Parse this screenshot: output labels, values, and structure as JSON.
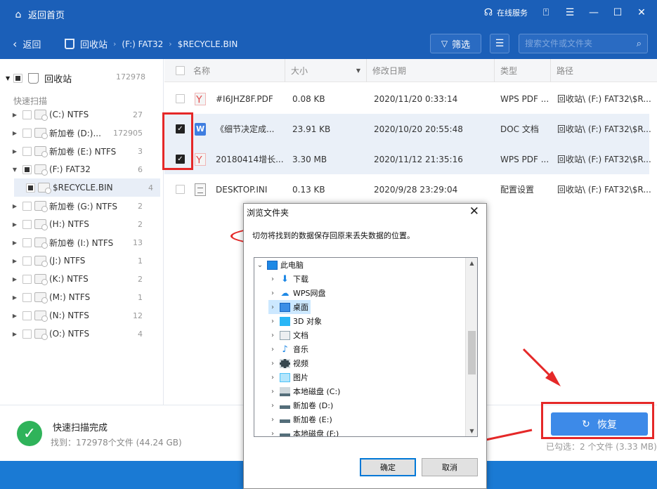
{
  "titlebar": {
    "home_label": "返回首页",
    "service_label": "在线服务"
  },
  "toolbar": {
    "back_label": "返回",
    "breadcrumb": [
      "回收站",
      "(F:) FAT32",
      "$RECYCLE.BIN"
    ],
    "filter_label": "筛选",
    "search_placeholder": "搜索文件或文件夹"
  },
  "tree": {
    "root": {
      "label": "回收站",
      "count": "172978"
    },
    "section_label": "快速扫描",
    "items": [
      {
        "label": "(C:) NTFS",
        "count": "27"
      },
      {
        "label": "新加卷 (D:)...",
        "count": "172905"
      },
      {
        "label": "新加卷 (E:) NTFS",
        "count": "3"
      },
      {
        "label": "(F:) FAT32",
        "count": "6"
      },
      {
        "label": "$RECYCLE.BIN",
        "count": "4"
      },
      {
        "label": "新加卷 (G:) NTFS",
        "count": "2"
      },
      {
        "label": "(H:) NTFS",
        "count": "2"
      },
      {
        "label": "新加卷 (I:) NTFS",
        "count": "13"
      },
      {
        "label": "(J:) NTFS",
        "count": "1"
      },
      {
        "label": "(K:) NTFS",
        "count": "2"
      },
      {
        "label": "(M:) NTFS",
        "count": "1"
      },
      {
        "label": "(N:) NTFS",
        "count": "12"
      },
      {
        "label": "(O:) NTFS",
        "count": "4"
      }
    ]
  },
  "table": {
    "columns": [
      "名称",
      "大小",
      "修改日期",
      "类型",
      "路径"
    ],
    "rows": [
      {
        "name": "#I6JHZ8F.PDF",
        "size": "0.08 KB",
        "date": "2020/11/20 0:33:14",
        "type": "WPS PDF ...",
        "path": "回收站\\ (F:) FAT32\\$R...",
        "checked": false,
        "icon": "pdf-icon"
      },
      {
        "name": "《细节决定成...",
        "size": "23.91 KB",
        "date": "2020/10/20 20:55:48",
        "type": "DOC 文档",
        "path": "回收站\\ (F:) FAT32\\$R...",
        "checked": true,
        "icon": "word-doc-icon"
      },
      {
        "name": "20180414增长...",
        "size": "3.30 MB",
        "date": "2020/11/12 21:35:16",
        "type": "WPS PDF ...",
        "path": "回收站\\ (F:) FAT32\\$R...",
        "checked": true,
        "icon": "pdf-icon"
      },
      {
        "name": "DESKTOP.INI",
        "size": "0.13 KB",
        "date": "2020/9/28 23:29:04",
        "type": "配置设置",
        "path": "回收站\\ (F:) FAT32\\$R...",
        "checked": false,
        "icon": "ini-file-icon"
      }
    ]
  },
  "status": {
    "title": "快速扫描完成",
    "found": "找到：172978个文件 (44.24 GB)",
    "recover_label": "恢复",
    "selected": "已勾选：2 个文件 (3.33 MB)"
  },
  "dialog": {
    "title": "浏览文件夹",
    "description": "切勿将找到的数据保存回原来丢失数据的位置。",
    "folders": [
      {
        "label": "此电脑",
        "icon": "computer-icon",
        "expanded": true,
        "selected": false,
        "level": 0
      },
      {
        "label": "下载",
        "icon": "download-folder-icon",
        "expanded": false,
        "selected": false,
        "level": 1
      },
      {
        "label": "WPS网盘",
        "icon": "cloud-icon",
        "expanded": false,
        "selected": false,
        "level": 1
      },
      {
        "label": "桌面",
        "icon": "desktop-icon",
        "expanded": false,
        "selected": true,
        "level": 1
      },
      {
        "label": "3D 对象",
        "icon": "3d-objects-icon",
        "expanded": false,
        "selected": false,
        "level": 1
      },
      {
        "label": "文档",
        "icon": "documents-icon",
        "expanded": false,
        "selected": false,
        "level": 1
      },
      {
        "label": "音乐",
        "icon": "music-icon",
        "expanded": false,
        "selected": false,
        "level": 1
      },
      {
        "label": "视频",
        "icon": "video-icon",
        "expanded": false,
        "selected": false,
        "level": 1
      },
      {
        "label": "图片",
        "icon": "pictures-icon",
        "expanded": false,
        "selected": false,
        "level": 1
      },
      {
        "label": "本地磁盘 (C:)",
        "icon": "drive-c-icon",
        "expanded": false,
        "selected": false,
        "level": 1
      },
      {
        "label": "新加卷 (D:)",
        "icon": "drive-icon",
        "expanded": false,
        "selected": false,
        "level": 1
      },
      {
        "label": "新加卷 (E:)",
        "icon": "drive-icon",
        "expanded": false,
        "selected": false,
        "level": 1
      },
      {
        "label": "本地磁盘 (F:)",
        "icon": "drive-icon",
        "expanded": false,
        "selected": false,
        "level": 1
      }
    ],
    "ok_label": "确定",
    "cancel_label": "取消"
  },
  "colors": {
    "brand": "#1b5fb8",
    "accent": "#3d8ae8",
    "annotation": "#e52828",
    "success": "#2fb35a"
  }
}
